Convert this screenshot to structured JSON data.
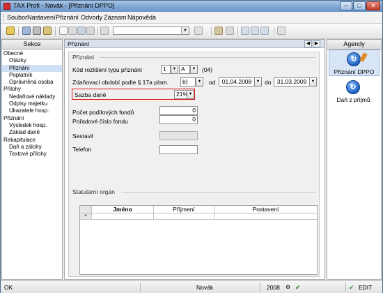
{
  "window": {
    "title": "TAX Profi - Novák - [Přiznání DPPO]"
  },
  "window_buttons": {
    "minimize": "–",
    "maximize": "□",
    "close": "✕"
  },
  "menu": [
    {
      "label": "Soubor"
    },
    {
      "label": "Nastavení"
    },
    {
      "label": "Přiznání"
    },
    {
      "label": "Odvody"
    },
    {
      "label": "Záznam"
    },
    {
      "label": "Nápověda"
    }
  ],
  "toolbar": {
    "combo_value": ""
  },
  "sidebar": {
    "header": "Sekce",
    "items": [
      {
        "label": "Obecné",
        "indent": 0
      },
      {
        "label": "Otázky",
        "indent": 1
      },
      {
        "label": "Přiznání",
        "indent": 1,
        "selected": true
      },
      {
        "label": "Poplatník",
        "indent": 1
      },
      {
        "label": "Oprávněná osoba",
        "indent": 1
      },
      {
        "label": "Přílohy",
        "indent": 0
      },
      {
        "label": "Nedaňové náklady",
        "indent": 1
      },
      {
        "label": "Odpisy majetku",
        "indent": 1
      },
      {
        "label": "Ukazatele hosp.",
        "indent": 1
      },
      {
        "label": "Přiznání",
        "indent": 0
      },
      {
        "label": "Výsledek hosp.",
        "indent": 1
      },
      {
        "label": "Základ daně",
        "indent": 1
      },
      {
        "label": "Rekapitulace",
        "indent": 0
      },
      {
        "label": "Daň a zálohy",
        "indent": 1
      },
      {
        "label": "Textové přílohy",
        "indent": 1
      }
    ]
  },
  "main": {
    "panel_title": "Přiznání",
    "nav_prev": "◀",
    "nav_next": "▶",
    "group_title": "Přiznání",
    "kod_label": "Kód rozlišení typu přiznání",
    "kod_value": "1",
    "kod_letter": "A",
    "kod_code": "(04)",
    "obdobi_label": "Zdaňovací období podle § 17a písm.",
    "obdobi_value": "b)",
    "od_label": "od",
    "od_value": "01.04.2008",
    "do_label": "do",
    "do_value": "31.03.2009",
    "sazba_label": "Sazba daně",
    "sazba_value": "21%",
    "pocet_label": "Počet podílových fondů",
    "pocet_value": "0",
    "poradove_label": "Pořadové číslo fondu",
    "poradove_value": "0",
    "sestavil_label": "Sestavil",
    "telefon_label": "Telefon",
    "stat_title": "Statutární orgán",
    "table": {
      "columns": [
        "Jméno",
        "Příjmení",
        "Postavení"
      ],
      "new_row_marker": "*"
    },
    "dropdown_arrow": "▼"
  },
  "agenda": {
    "header": "Agendy",
    "items": [
      {
        "label": "Přiznání DPPO",
        "icon": "circular-arrow-icon"
      },
      {
        "label": "Daň z příjmů",
        "icon": "circular-arrow-icon"
      }
    ]
  },
  "status": {
    "left": "OK",
    "user": "Novák",
    "year": "2008",
    "mode": "EDIT"
  },
  "colors": {
    "highlight": "#e01010",
    "selection": "#cfe0f5",
    "accent": "#1b5fbf"
  }
}
